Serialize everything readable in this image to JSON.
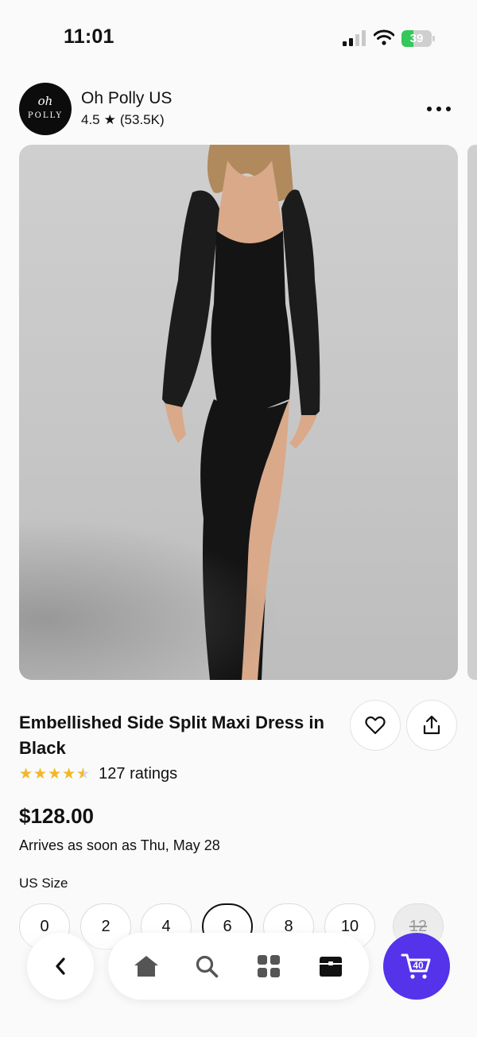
{
  "status_bar": {
    "time": "11:01",
    "battery_level": "39",
    "battery_fraction": 0.39,
    "battery_color": "#34c759"
  },
  "store": {
    "logo_script": "oh",
    "logo_word": "POLLY",
    "name": "Oh Polly US",
    "rating": "4.5",
    "reviews": "(53.5K)"
  },
  "product": {
    "title": "Embellished Side Split Maxi Dress in Black",
    "stars": "★★★★★",
    "rating_fraction": 0.9,
    "ratings_count": "127 ratings",
    "price": "$128.00",
    "arrival": "Arrives as soon as Thu, May 28"
  },
  "size": {
    "label": "US Size",
    "options": [
      "0",
      "2",
      "4",
      "6",
      "8",
      "10",
      "12"
    ],
    "selected": "6",
    "unavailable": [
      "12"
    ]
  },
  "cart": {
    "count": "40",
    "color": "#5433eb"
  },
  "icons": {
    "back": "chevron-left-icon",
    "home": "home-icon",
    "search": "search-icon",
    "categories": "grid-icon",
    "orders": "package-icon",
    "cart": "cart-icon",
    "favorite": "heart-icon",
    "share": "share-icon",
    "more": "more-icon"
  }
}
